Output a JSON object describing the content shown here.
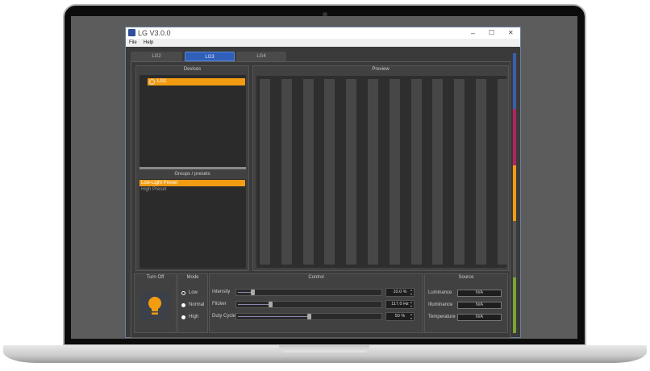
{
  "window": {
    "title": "LG V3.0.0",
    "controls": [
      "–",
      "☐",
      "✕"
    ]
  },
  "menu": [
    "File",
    "Help"
  ],
  "tabs": [
    {
      "label": "LG2"
    },
    {
      "label": "LG3",
      "selected": true
    },
    {
      "label": "LG4"
    }
  ],
  "devices": {
    "title": "Devices",
    "items": [
      "LG1"
    ]
  },
  "groups": {
    "title": "Groups / presets",
    "items": [
      "Low-Light Preset",
      "High Preset"
    ]
  },
  "preview": {
    "title": "Preview",
    "bar_count": 12
  },
  "turn_off": {
    "title": "Turn Off"
  },
  "mode": {
    "title": "Mode",
    "options": [
      "Low",
      "Normal",
      "High"
    ],
    "selected": "Low"
  },
  "control": {
    "title": "Control",
    "rows": [
      {
        "label": "Intensity",
        "value": "10.0 %",
        "fraction": 0.1
      },
      {
        "label": "Flicker",
        "value": "117.0 Hz",
        "fraction": 0.23
      },
      {
        "label": "Duty Cycle",
        "value": "50 %",
        "fraction": 0.5
      }
    ]
  },
  "source": {
    "title": "Source",
    "rows": [
      {
        "label": "Luminance",
        "value": "N/A"
      },
      {
        "label": "Illuminance",
        "value": "N/A"
      },
      {
        "label": "Temperature",
        "value": "N/A"
      }
    ]
  },
  "colors": {
    "accent": "#f39c12",
    "tab_selected": "#2f5fb8",
    "strip": [
      "#3b5fb0",
      "#b0245f",
      "#f39c12",
      "#555555",
      "#7aa532"
    ]
  }
}
